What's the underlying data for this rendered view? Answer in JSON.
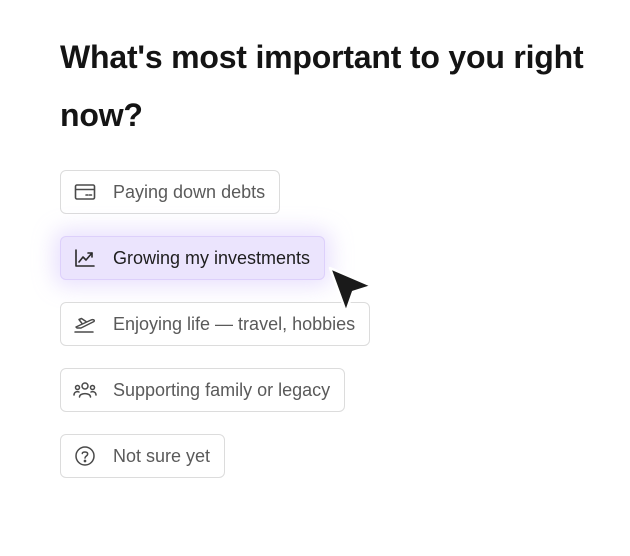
{
  "question": {
    "title": "What's most important to you right now?"
  },
  "options": [
    {
      "label": "Paying down debts",
      "icon": "credit-card-icon",
      "selected": false
    },
    {
      "label": "Growing my investments",
      "icon": "chart-line-icon",
      "selected": true
    },
    {
      "label": "Enjoying life — travel, hobbies",
      "icon": "airplane-icon",
      "selected": false
    },
    {
      "label": "Supporting family or legacy",
      "icon": "people-icon",
      "selected": false
    },
    {
      "label": "Not sure yet",
      "icon": "question-circle-icon",
      "selected": false
    }
  ],
  "colors": {
    "selected_background": "#ebe4fd",
    "selected_border": "#ddd0fb",
    "border": "#dcdcdc",
    "title_text": "#141414",
    "cursor": "#1a1a1a"
  }
}
